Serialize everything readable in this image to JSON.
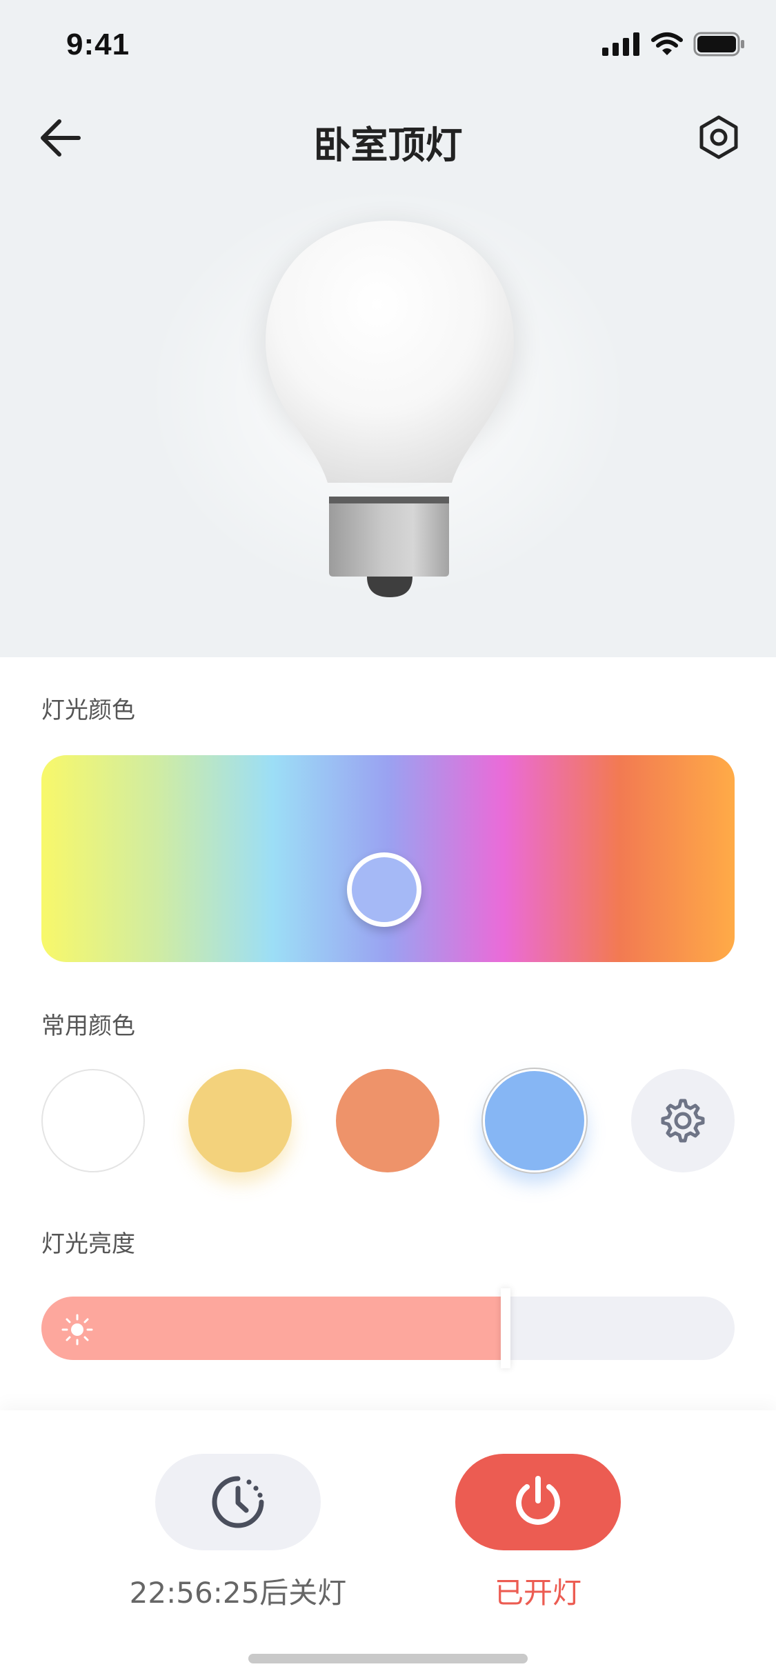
{
  "status_bar": {
    "time": "9:41"
  },
  "nav": {
    "title": "卧室顶灯",
    "back_icon": "arrow-left-icon",
    "settings_icon": "hexagon-settings-icon"
  },
  "light_color": {
    "label": "灯光颜色",
    "gradient_stops": [
      "#f8f86a",
      "#d0eca2",
      "#9cdef6",
      "#9aa2f1",
      "#ea6bd8",
      "#f27a52",
      "#ffab47"
    ],
    "selected_color": "#a5b9f6"
  },
  "common_colors": {
    "label": "常用颜色",
    "swatches": [
      {
        "name": "white",
        "color": "#ffffff"
      },
      {
        "name": "warm-yellow",
        "color": "#f3d27c"
      },
      {
        "name": "orange",
        "color": "#ee936a"
      },
      {
        "name": "blue",
        "color": "#86b6f4",
        "selected": true
      }
    ],
    "edit_icon": "gear-icon"
  },
  "brightness": {
    "label": "灯光亮度",
    "level": 0.67,
    "fill_color": "#fda79d",
    "icon": "sun-icon"
  },
  "timer": {
    "label": "22:56:25后关灯",
    "icon": "timer-icon"
  },
  "power": {
    "label": "已开灯",
    "icon": "power-icon",
    "color": "#ec5c52"
  }
}
